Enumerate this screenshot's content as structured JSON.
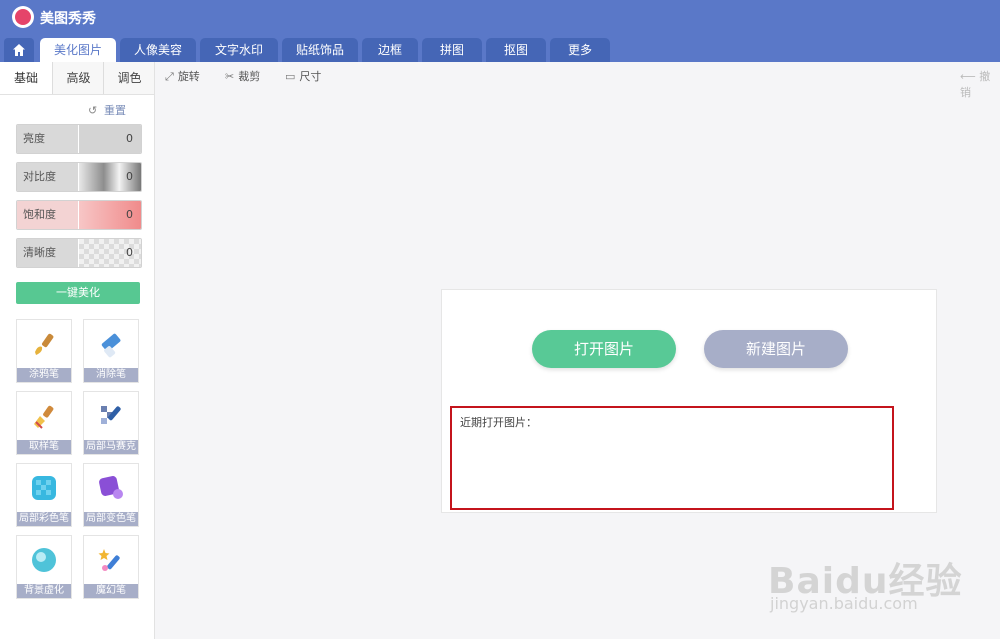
{
  "app": {
    "title": "美图秀秀"
  },
  "tabs": [
    {
      "label": "美化图片",
      "active": true
    },
    {
      "label": "人像美容"
    },
    {
      "label": "文字水印"
    },
    {
      "label": "贴纸饰品"
    },
    {
      "label": "边框"
    },
    {
      "label": "拼图"
    },
    {
      "label": "抠图"
    },
    {
      "label": "更多"
    }
  ],
  "left_panel": {
    "subtabs": [
      "基础",
      "高级",
      "调色"
    ],
    "reset_label": "重置",
    "sliders": [
      {
        "label": "亮度",
        "value": "0"
      },
      {
        "label": "对比度",
        "value": "0"
      },
      {
        "label": "饱和度",
        "value": "0"
      },
      {
        "label": "清晰度",
        "value": "0"
      }
    ],
    "beautify_label": "一键美化",
    "tools": [
      {
        "label": "涂鸦笔",
        "icon": "paintbrush-icon"
      },
      {
        "label": "消除笔",
        "icon": "eraser-icon"
      },
      {
        "label": "取样笔",
        "icon": "sampling-brush-icon"
      },
      {
        "label": "局部马赛克",
        "icon": "mosaic-pen-icon"
      },
      {
        "label": "局部彩色笔",
        "icon": "color-pen-icon"
      },
      {
        "label": "局部变色笔",
        "icon": "recolor-pen-icon"
      },
      {
        "label": "背景虚化",
        "icon": "blur-background-icon"
      },
      {
        "label": "魔幻笔",
        "icon": "magic-pen-icon"
      }
    ]
  },
  "toolbar": {
    "rotate_label": "旋转",
    "crop_label": "裁剪",
    "size_label": "尺寸",
    "undo_label": "撤销"
  },
  "main": {
    "open_label": "打开图片",
    "new_label": "新建图片",
    "recent_title": "近期打开图片："
  },
  "watermark": {
    "brand": "Baidu经验",
    "url": "jingyan.baidu.com"
  },
  "colors": {
    "header": "#5a78c8",
    "accent_green": "#58c996",
    "button_gray": "#a7aec8",
    "highlight_red": "#c4141c"
  }
}
